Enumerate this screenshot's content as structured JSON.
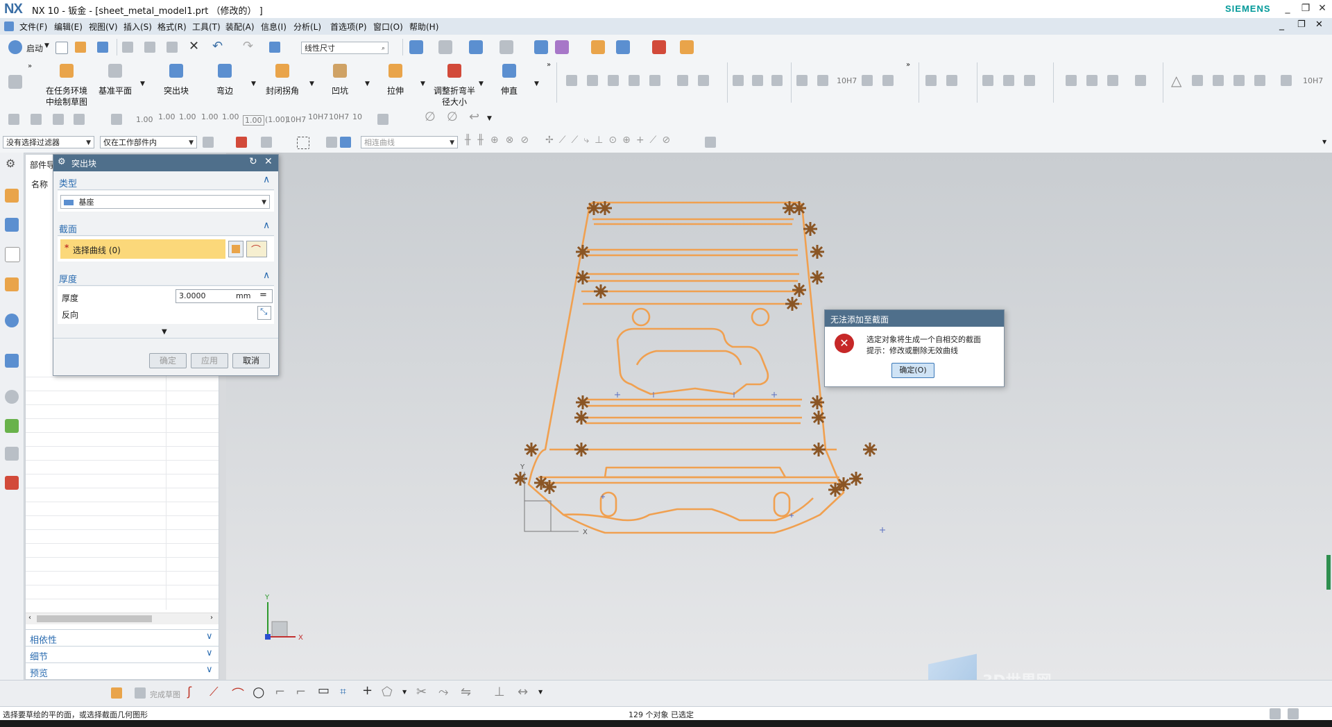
{
  "window": {
    "logo": "NX",
    "title": "NX 10 - 钣金 - [sheet_metal_model1.prt （修改的） ]",
    "brand": "SIEMENS",
    "controls": [
      "_",
      "❐",
      "✕"
    ]
  },
  "menu": {
    "items": [
      "文件(F)",
      "编辑(E)",
      "视图(V)",
      "插入(S)",
      "格式(R)",
      "工具(T)",
      "装配(A)",
      "信息(I)",
      "分析(L)",
      "首选项(P)",
      "窗口(O)",
      "帮助(H)"
    ],
    "doc_controls": [
      "_",
      "❐",
      "✕"
    ]
  },
  "toolbar1": {
    "start_label": "启动",
    "dimension_combo": "线性尺寸"
  },
  "toolbar2": {
    "buttons": [
      {
        "label1": "在任务环境",
        "label2": "中绘制草图"
      },
      {
        "label1": "基准平面",
        "label2": ""
      },
      {
        "label1": "突出块",
        "label2": ""
      },
      {
        "label1": "弯边",
        "label2": ""
      },
      {
        "label1": "封闭拐角",
        "label2": ""
      },
      {
        "label1": "凹坑",
        "label2": ""
      },
      {
        "label1": "拉伸",
        "label2": ""
      },
      {
        "label1": "调整折弯半",
        "label2": "径大小"
      },
      {
        "label1": "伸直",
        "label2": ""
      }
    ]
  },
  "toolbar3": {
    "numbers": [
      "1.00",
      "1.00",
      "1.00",
      "1.00",
      "1.00",
      "1.00",
      "(1.00)",
      "10H7",
      "10H7",
      "10H7",
      "10"
    ]
  },
  "selection_bar": {
    "filter": "没有选择过滤器",
    "scope": "仅在工作部件内",
    "curve_rule": "相连曲线"
  },
  "nav_panel": {
    "title": "部件导",
    "column_name": "名称",
    "sections": [
      "相依性",
      "细节",
      "预览"
    ]
  },
  "dialog": {
    "title": "突出块",
    "type_section": "类型",
    "type_value": "基座",
    "section_section": "截面",
    "select_curve": "选择曲线 (0)",
    "thickness_section": "厚度",
    "thickness_label": "厚度",
    "thickness_value": "3.0000",
    "thickness_unit": "mm",
    "reverse_label": "反向",
    "ok": "确定",
    "apply": "应用",
    "cancel": "取消"
  },
  "error_dialog": {
    "title": "无法添加至截面",
    "line1": "选定对象将生成一个自相交的截面",
    "line2": "提示：修改或删除无效曲线",
    "ok": "确定(O)"
  },
  "bottom_toolbar": {
    "finish_label": "完成草图"
  },
  "status": {
    "prompt": "选择要草绘的平的面，或选择截面几何图形",
    "selection_count": "129 个对象 已选定"
  },
  "axes": {
    "x": "X",
    "y": "Y"
  },
  "watermark": "3D世界网",
  "colors": {
    "sketch_curve": "#f0a050",
    "constraint_marker": "#8a5524",
    "accent_blue": "#2b6cb0",
    "dialog_title": "#4f6f8b",
    "selection_highlight": "#fbd87a"
  }
}
